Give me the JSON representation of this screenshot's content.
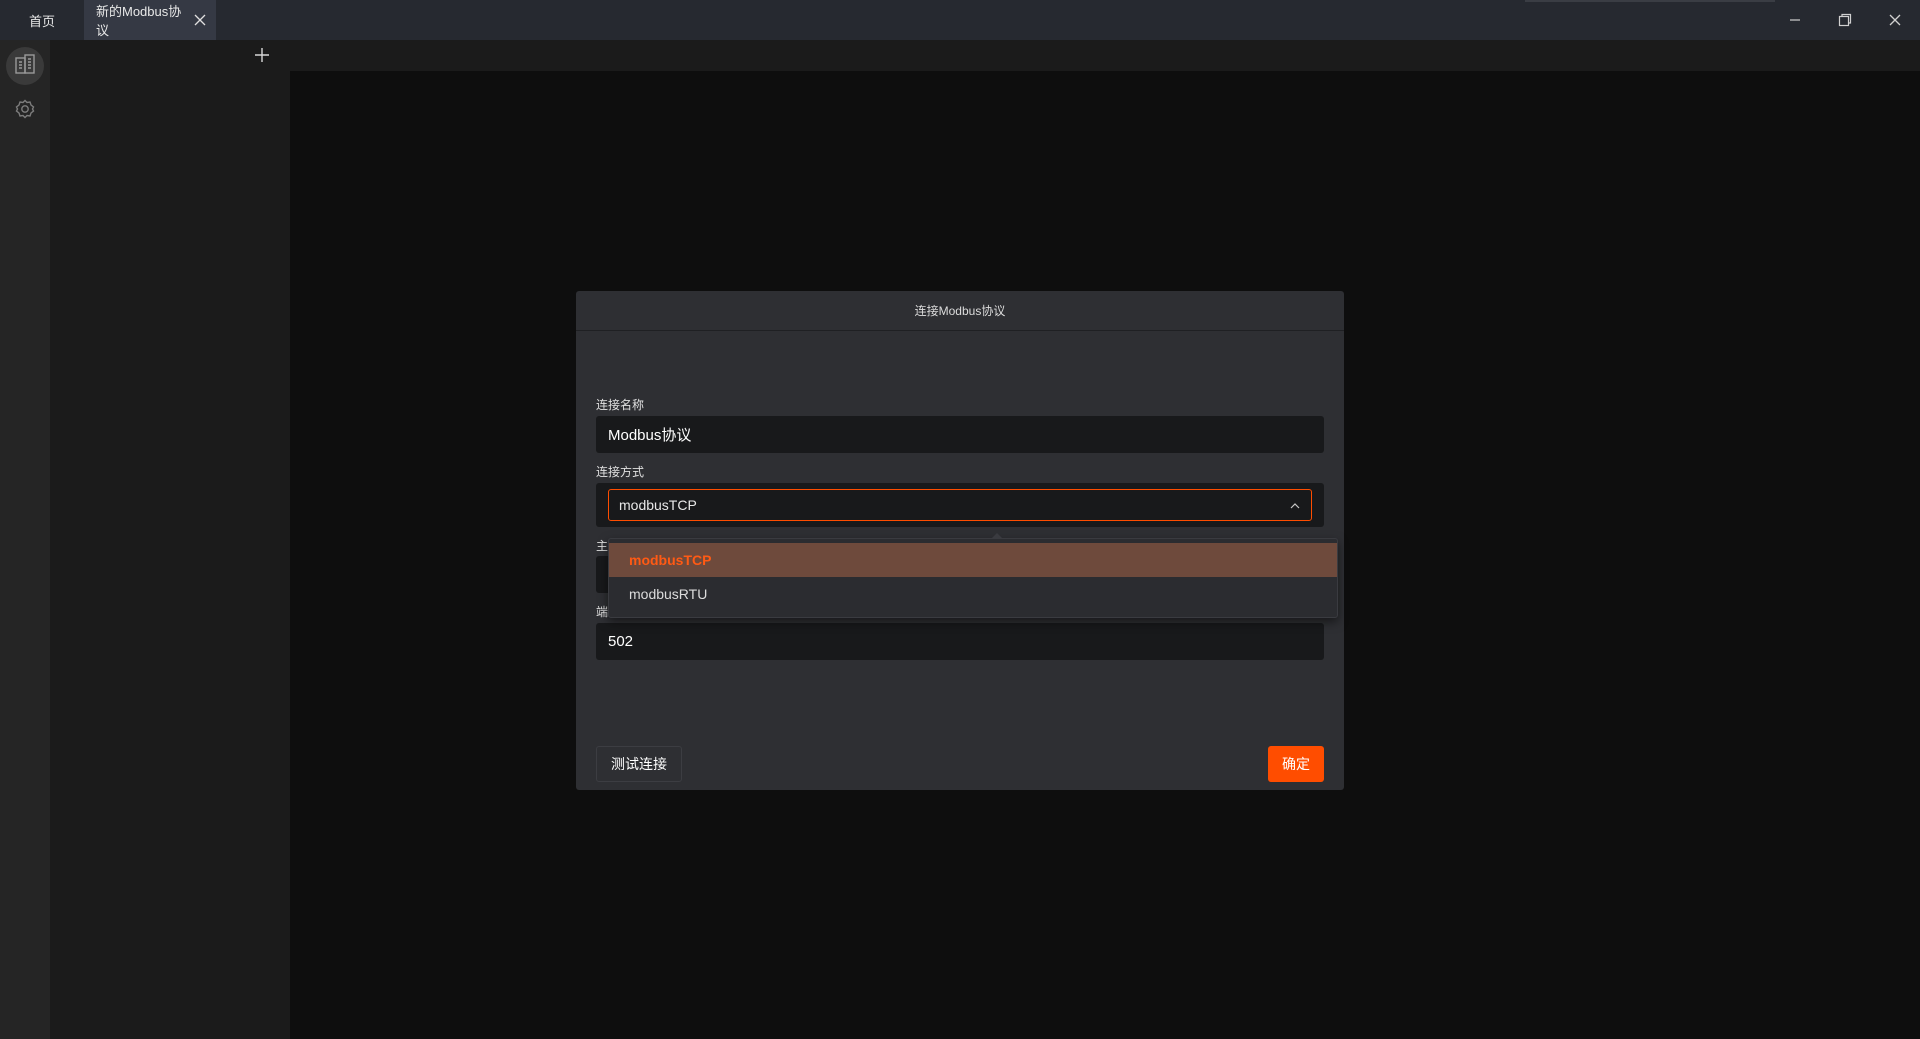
{
  "tabs": [
    {
      "label": "首页"
    },
    {
      "label": "新的Modbus协议"
    }
  ],
  "window_controls": {
    "minimize": "minimize-icon",
    "restore": "restore-icon",
    "close": "close-icon"
  },
  "rail": {
    "items": [
      {
        "icon": "building-icon",
        "selected": true
      },
      {
        "icon": "gear-icon",
        "selected": false
      }
    ]
  },
  "panel": {
    "add_icon": "plus-icon"
  },
  "dialog": {
    "title": "连接Modbus协议",
    "fields": {
      "name_label": "连接名称",
      "name_value": "Modbus协议",
      "method_label": "连接方式",
      "method_value": "modbusTCP",
      "host_label_partial": "主",
      "port_label_partial": "端",
      "port_value": "502"
    },
    "dropdown_options": [
      {
        "label": "modbusTCP",
        "selected": true
      },
      {
        "label": "modbusRTU",
        "selected": false
      }
    ],
    "test_button": "测试连接",
    "ok_button": "确定"
  },
  "colors": {
    "accent": "#ff4d00",
    "titlebar": "#262930",
    "dialog_bg": "#2e2f33"
  }
}
